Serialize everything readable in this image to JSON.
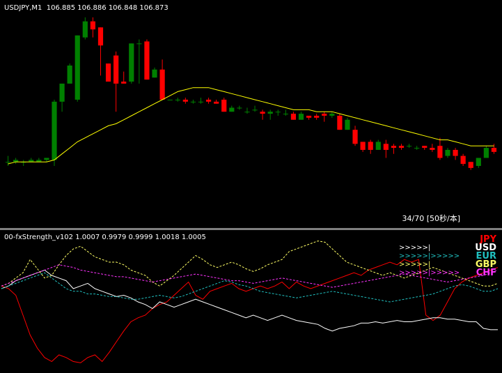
{
  "main": {
    "header": "USDJPY,M1  106.885 106.886 106.848 106.873",
    "pager": "34/70 [50秒/本]",
    "colors": {
      "up": "#008000",
      "down": "#ff0000",
      "ma": "#ffff00",
      "text": "#ffffff"
    }
  },
  "sub": {
    "header": "00-fxStrength_v102 1.0007 0.9979 0.9999 1.0018 1.0005",
    "legend": [
      {
        "name": "JPY",
        "arrow": "",
        "color": "#ff0000",
        "dashed": false
      },
      {
        "name": "USD",
        "arrow": ">>>>>|",
        "color": "#ffffff",
        "dashed": false
      },
      {
        "name": "EUR",
        "arrow": ">>>>>|>>>>>",
        "color": "#20c0c0",
        "dashed": true
      },
      {
        "name": "GBP",
        "arrow": ">>>>>|",
        "color": "#ffff66",
        "dashed": true
      },
      {
        "name": "CHF",
        "arrow": ">>>>>|>>>>>",
        "color": "#ff33ff",
        "dashed": true
      }
    ]
  },
  "chart_data": [
    {
      "type": "candlestick",
      "title": "USDJPY,M1",
      "values": {
        "open": 106.885,
        "high": 106.886,
        "low": 106.848,
        "close": 106.873
      },
      "candles": [
        [
          0.27,
          0.27,
          0.3,
          0.25
        ],
        [
          0.27,
          0.28,
          0.29,
          0.26
        ],
        [
          0.27,
          0.27,
          0.28,
          0.25
        ],
        [
          0.27,
          0.28,
          0.29,
          0.27
        ],
        [
          0.27,
          0.28,
          0.29,
          0.27
        ],
        [
          0.28,
          0.29,
          0.29,
          0.27
        ],
        [
          0.28,
          0.57,
          0.58,
          0.25
        ],
        [
          0.57,
          0.66,
          0.66,
          0.52
        ],
        [
          0.66,
          0.75,
          0.76,
          0.66
        ],
        [
          0.58,
          0.9,
          0.9,
          0.57
        ],
        [
          0.89,
          0.97,
          0.99,
          0.88
        ],
        [
          0.97,
          0.93,
          0.99,
          0.89
        ],
        [
          0.94,
          0.85,
          0.94,
          0.7
        ],
        [
          0.76,
          0.67,
          0.76,
          0.67
        ],
        [
          0.8,
          0.66,
          0.82,
          0.52
        ],
        [
          0.67,
          0.66,
          0.72,
          0.66
        ],
        [
          0.67,
          0.86,
          0.86,
          0.66
        ],
        [
          0.86,
          0.86,
          0.88,
          0.66
        ],
        [
          0.87,
          0.68,
          0.88,
          0.68
        ],
        [
          0.69,
          0.73,
          0.74,
          0.69
        ],
        [
          0.73,
          0.58,
          0.78,
          0.58
        ],
        [
          0.58,
          0.58,
          0.58,
          0.58
        ],
        [
          0.58,
          0.58,
          0.59,
          0.57
        ],
        [
          0.58,
          0.57,
          0.59,
          0.56
        ],
        [
          0.57,
          0.57,
          0.58,
          0.56
        ],
        [
          0.57,
          0.57,
          0.59,
          0.56
        ],
        [
          0.58,
          0.57,
          0.59,
          0.56
        ],
        [
          0.57,
          0.56,
          0.58,
          0.56
        ],
        [
          0.58,
          0.52,
          0.59,
          0.52
        ],
        [
          0.52,
          0.54,
          0.55,
          0.52
        ],
        [
          0.54,
          0.54,
          0.55,
          0.53
        ],
        [
          0.52,
          0.52,
          0.54,
          0.51
        ],
        [
          0.53,
          0.53,
          0.55,
          0.52
        ],
        [
          0.52,
          0.51,
          0.53,
          0.48
        ],
        [
          0.51,
          0.52,
          0.53,
          0.48
        ],
        [
          0.52,
          0.52,
          0.53,
          0.5
        ],
        [
          0.51,
          0.51,
          0.53,
          0.5
        ],
        [
          0.51,
          0.48,
          0.52,
          0.48
        ],
        [
          0.48,
          0.51,
          0.52,
          0.48
        ],
        [
          0.5,
          0.49,
          0.5,
          0.48
        ],
        [
          0.5,
          0.49,
          0.51,
          0.48
        ],
        [
          0.51,
          0.5,
          0.52,
          0.47
        ],
        [
          0.5,
          0.51,
          0.52,
          0.49
        ],
        [
          0.5,
          0.43,
          0.51,
          0.43
        ],
        [
          0.43,
          0.48,
          0.49,
          0.43
        ],
        [
          0.43,
          0.36,
          0.45,
          0.35
        ],
        [
          0.37,
          0.33,
          0.37,
          0.32
        ],
        [
          0.37,
          0.33,
          0.38,
          0.31
        ],
        [
          0.33,
          0.37,
          0.38,
          0.33
        ],
        [
          0.36,
          0.33,
          0.38,
          0.29
        ],
        [
          0.35,
          0.34,
          0.36,
          0.31
        ],
        [
          0.35,
          0.34,
          0.36,
          0.33
        ],
        [
          0.35,
          0.35,
          0.36,
          0.34
        ],
        [
          0.34,
          0.34,
          0.35,
          0.33
        ],
        [
          0.35,
          0.34,
          0.35,
          0.33
        ],
        [
          0.34,
          0.33,
          0.36,
          0.32
        ],
        [
          0.35,
          0.29,
          0.39,
          0.28
        ],
        [
          0.3,
          0.33,
          0.34,
          0.29
        ],
        [
          0.33,
          0.3,
          0.34,
          0.28
        ],
        [
          0.3,
          0.26,
          0.31,
          0.25
        ],
        [
          0.27,
          0.24,
          0.27,
          0.23
        ],
        [
          0.25,
          0.29,
          0.29,
          0.24
        ],
        [
          0.29,
          0.34,
          0.35,
          0.29
        ],
        [
          0.34,
          0.32,
          0.36,
          0.31
        ]
      ],
      "ma": [
        0.26,
        0.27,
        0.27,
        0.27,
        0.27,
        0.27,
        0.28,
        0.31,
        0.34,
        0.37,
        0.39,
        0.41,
        0.43,
        0.45,
        0.46,
        0.48,
        0.5,
        0.52,
        0.54,
        0.56,
        0.58,
        0.6,
        0.62,
        0.63,
        0.64,
        0.64,
        0.64,
        0.63,
        0.62,
        0.61,
        0.6,
        0.59,
        0.58,
        0.57,
        0.56,
        0.55,
        0.54,
        0.53,
        0.53,
        0.53,
        0.52,
        0.52,
        0.52,
        0.51,
        0.5,
        0.49,
        0.48,
        0.47,
        0.46,
        0.45,
        0.44,
        0.43,
        0.42,
        0.41,
        0.4,
        0.39,
        0.38,
        0.38,
        0.37,
        0.36,
        0.35,
        0.35,
        0.35,
        0.35
      ]
    },
    {
      "type": "line",
      "title": "00-fxStrength_v102",
      "x": [
        0,
        1,
        2,
        3,
        4,
        5,
        6,
        7,
        8,
        9,
        10,
        11,
        12,
        13,
        14,
        15,
        16,
        17,
        18,
        19,
        20,
        21,
        22,
        23,
        24,
        25,
        26,
        27,
        28,
        29,
        30,
        31,
        32,
        33,
        34,
        35,
        36,
        37,
        38,
        39,
        40,
        41,
        42,
        43,
        44,
        45,
        46,
        47,
        48,
        49,
        50,
        51,
        52,
        53,
        54,
        55,
        56,
        57,
        58,
        59,
        60,
        61,
        62,
        63,
        64,
        65,
        66,
        67,
        68,
        69
      ],
      "series": [
        {
          "name": "JPY",
          "values": [
            0.62,
            0.6,
            0.55,
            0.4,
            0.25,
            0.15,
            0.08,
            0.05,
            0.1,
            0.08,
            0.05,
            0.04,
            0.08,
            0.1,
            0.05,
            0.12,
            0.2,
            0.28,
            0.35,
            0.38,
            0.4,
            0.45,
            0.48,
            0.5,
            0.55,
            0.6,
            0.65,
            0.55,
            0.52,
            0.58,
            0.6,
            0.62,
            0.64,
            0.6,
            0.58,
            0.6,
            0.62,
            0.6,
            0.62,
            0.65,
            0.6,
            0.65,
            0.62,
            0.6,
            0.62,
            0.64,
            0.66,
            0.68,
            0.7,
            0.72,
            0.7,
            0.74,
            0.76,
            0.78,
            0.8,
            0.78,
            0.82,
            0.8,
            0.82,
            0.4,
            0.36,
            0.4,
            0.5,
            0.6,
            0.65,
            0.68,
            0.7,
            0.72,
            0.74,
            0.76
          ]
        },
        {
          "name": "USD",
          "values": [
            0.6,
            0.62,
            0.66,
            0.68,
            0.7,
            0.72,
            0.74,
            0.7,
            0.68,
            0.66,
            0.6,
            0.62,
            0.64,
            0.6,
            0.58,
            0.56,
            0.54,
            0.55,
            0.53,
            0.5,
            0.48,
            0.45,
            0.5,
            0.48,
            0.46,
            0.48,
            0.5,
            0.52,
            0.5,
            0.48,
            0.46,
            0.44,
            0.42,
            0.4,
            0.38,
            0.4,
            0.38,
            0.36,
            0.38,
            0.4,
            0.38,
            0.36,
            0.35,
            0.34,
            0.33,
            0.3,
            0.28,
            0.3,
            0.31,
            0.32,
            0.34,
            0.34,
            0.35,
            0.34,
            0.35,
            0.36,
            0.35,
            0.35,
            0.36,
            0.37,
            0.38,
            0.38,
            0.37,
            0.37,
            0.36,
            0.35,
            0.35,
            0.3,
            0.29,
            0.29
          ]
        },
        {
          "name": "EUR",
          "values": [
            0.6,
            0.62,
            0.64,
            0.66,
            0.68,
            0.7,
            0.72,
            0.68,
            0.64,
            0.6,
            0.58,
            0.58,
            0.56,
            0.56,
            0.55,
            0.54,
            0.54,
            0.53,
            0.52,
            0.52,
            0.53,
            0.54,
            0.55,
            0.54,
            0.53,
            0.54,
            0.56,
            0.58,
            0.6,
            0.62,
            0.64,
            0.66,
            0.65,
            0.63,
            0.62,
            0.6,
            0.58,
            0.57,
            0.56,
            0.55,
            0.54,
            0.53,
            0.54,
            0.55,
            0.56,
            0.57,
            0.58,
            0.57,
            0.56,
            0.55,
            0.54,
            0.53,
            0.52,
            0.51,
            0.5,
            0.51,
            0.52,
            0.53,
            0.54,
            0.55,
            0.56,
            0.58,
            0.6,
            0.62,
            0.63,
            0.62,
            0.6,
            0.58,
            0.58,
            0.6
          ]
        },
        {
          "name": "GBP",
          "values": [
            0.62,
            0.64,
            0.68,
            0.72,
            0.82,
            0.75,
            0.68,
            0.7,
            0.78,
            0.85,
            0.9,
            0.92,
            0.88,
            0.84,
            0.82,
            0.8,
            0.8,
            0.78,
            0.74,
            0.72,
            0.7,
            0.65,
            0.62,
            0.66,
            0.7,
            0.75,
            0.8,
            0.85,
            0.82,
            0.78,
            0.76,
            0.78,
            0.8,
            0.78,
            0.75,
            0.73,
            0.75,
            0.78,
            0.8,
            0.82,
            0.88,
            0.9,
            0.92,
            0.94,
            0.96,
            0.95,
            0.9,
            0.85,
            0.8,
            0.78,
            0.76,
            0.74,
            0.72,
            0.7,
            0.72,
            0.7,
            0.68,
            0.7,
            0.72,
            0.74,
            0.76,
            0.74,
            0.72,
            0.7,
            0.68,
            0.66,
            0.64,
            0.62,
            0.62,
            0.64
          ]
        },
        {
          "name": "CHF",
          "values": [
            0.62,
            0.64,
            0.66,
            0.68,
            0.7,
            0.72,
            0.74,
            0.76,
            0.78,
            0.77,
            0.76,
            0.74,
            0.73,
            0.72,
            0.71,
            0.7,
            0.69,
            0.69,
            0.68,
            0.67,
            0.66,
            0.65,
            0.66,
            0.67,
            0.68,
            0.69,
            0.7,
            0.71,
            0.7,
            0.69,
            0.68,
            0.67,
            0.66,
            0.66,
            0.65,
            0.64,
            0.65,
            0.66,
            0.67,
            0.68,
            0.67,
            0.66,
            0.65,
            0.64,
            0.63,
            0.62,
            0.61,
            0.62,
            0.63,
            0.64,
            0.65,
            0.66,
            0.67,
            0.68,
            0.69,
            0.7,
            0.71,
            0.7,
            0.69,
            0.68,
            0.67,
            0.66,
            0.65,
            0.66,
            0.67,
            0.68,
            0.69,
            0.7,
            0.72,
            0.74
          ]
        }
      ]
    }
  ]
}
